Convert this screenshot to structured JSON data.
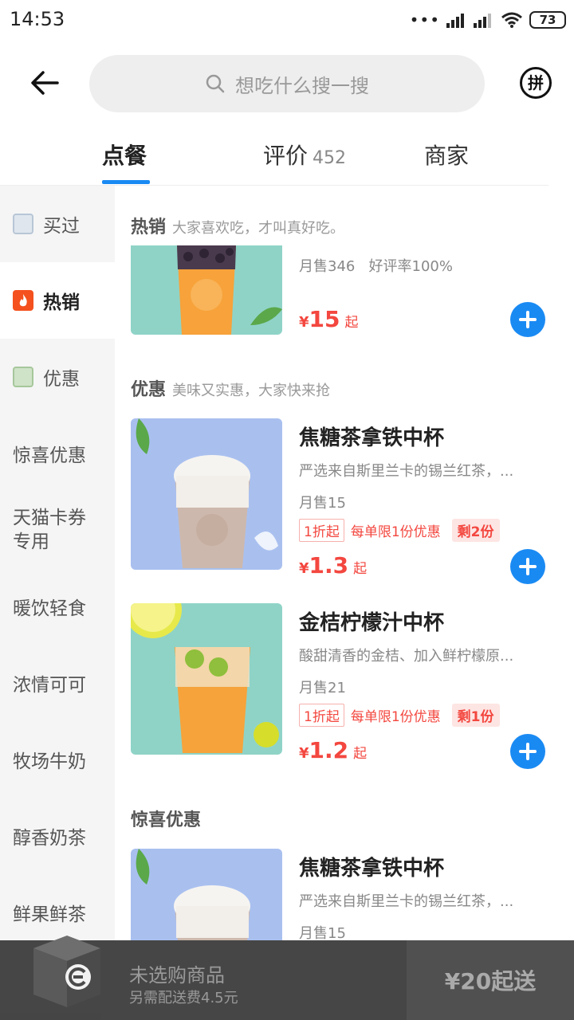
{
  "status": {
    "time": "14:53",
    "battery": "73",
    "signal_dots": "•••"
  },
  "header": {
    "search_placeholder": "想吃什么搜一搜",
    "pin_label": "拼"
  },
  "tabs": [
    {
      "label": "点餐",
      "count": ""
    },
    {
      "label": "评价",
      "count": "452"
    },
    {
      "label": "商家",
      "count": ""
    }
  ],
  "sidebar": {
    "items": [
      {
        "label": "买过",
        "icon": "receipt-icon",
        "active": false
      },
      {
        "label": "热销",
        "icon": "flame-icon",
        "active": true
      },
      {
        "label": "优惠",
        "icon": "discount-tag-icon",
        "active": false
      },
      {
        "label": "惊喜优惠"
      },
      {
        "label": "天猫卡券",
        "label2": "专用"
      },
      {
        "label": "暖饮轻食"
      },
      {
        "label": "浓情可可"
      },
      {
        "label": "牧场牛奶"
      },
      {
        "label": "醇香奶茶"
      },
      {
        "label": "鲜果鲜茶"
      }
    ]
  },
  "sections": {
    "hot": {
      "title": "热销",
      "subtitle": "大家喜欢吃，才叫真好吃。"
    },
    "discount": {
      "title": "优惠",
      "subtitle": "美味又实惠，大家快来抢"
    },
    "surprise": {
      "title": "惊喜优惠",
      "subtitle": ""
    }
  },
  "products": {
    "hot1": {
      "sales": "月售346",
      "rating": "好评率100%",
      "currency": "¥",
      "price": "15",
      "from": "起"
    },
    "caramel": {
      "name": "焦糖茶拿铁中杯",
      "desc": "严选来自斯里兰卡的锡兰红茶，...",
      "sales": "月售15",
      "discount": "1折起",
      "limit": "每单限1份优惠",
      "left": "剩2份",
      "currency": "¥",
      "price": "1.3",
      "from": "起"
    },
    "kumquat": {
      "name": "金桔柠檬汁中杯",
      "desc": "酸甜清香的金桔、加入鲜柠檬原...",
      "sales": "月售21",
      "discount": "1折起",
      "limit": "每单限1份优惠",
      "left": "剩1份",
      "currency": "¥",
      "price": "1.2",
      "from": "起"
    },
    "caramel2": {
      "name": "焦糖茶拿铁中杯",
      "desc": "严选来自斯里兰卡的锡兰红茶，...",
      "sales": "月售15"
    }
  },
  "cart": {
    "title": "未选购商品",
    "delivery_fee": "另需配送费4.5元",
    "min_order": "¥20起送"
  },
  "colors": {
    "accent": "#1a8af3",
    "price": "#f3473f",
    "sidebar_bg": "#f5f5f5"
  }
}
